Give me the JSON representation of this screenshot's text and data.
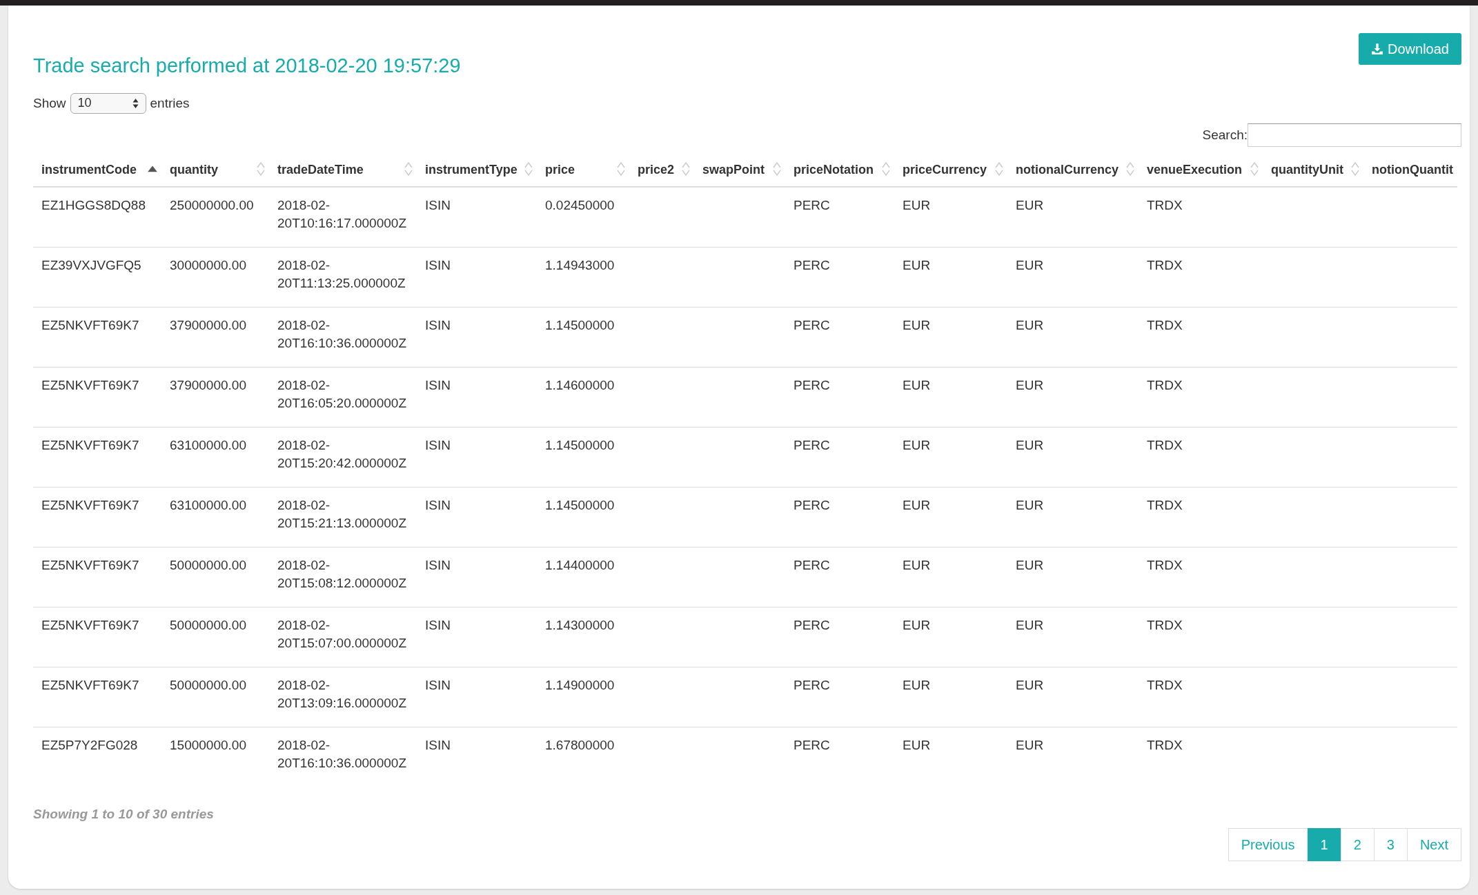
{
  "title": "Trade search performed at 2018-02-20 19:57:29",
  "download_button": "Download",
  "length_control": {
    "before": "Show",
    "value": "10",
    "after": "entries"
  },
  "search": {
    "label": "Search:"
  },
  "table": {
    "columns": [
      {
        "label": "instrumentCode",
        "sortable": true,
        "sorted": true
      },
      {
        "label": "quantity",
        "sortable": true,
        "sorted": false
      },
      {
        "label": "tradeDateTime",
        "sortable": true,
        "sorted": false
      },
      {
        "label": "instrumentType",
        "sortable": true,
        "sorted": false
      },
      {
        "label": "price",
        "sortable": true,
        "sorted": false
      },
      {
        "label": "price2",
        "sortable": true,
        "sorted": false
      },
      {
        "label": "swapPoint",
        "sortable": true,
        "sorted": false
      },
      {
        "label": "priceNotation",
        "sortable": true,
        "sorted": false
      },
      {
        "label": "priceCurrency",
        "sortable": true,
        "sorted": false
      },
      {
        "label": "notionalCurrency",
        "sortable": true,
        "sorted": false
      },
      {
        "label": "venueExecution",
        "sortable": true,
        "sorted": false
      },
      {
        "label": "quantityUnit",
        "sortable": true,
        "sorted": false
      },
      {
        "label": "notionQuantit"
      }
    ],
    "rows": [
      [
        "EZ1HGGS8DQ88",
        "250000000.00",
        "2018-02-20T10:16:17.000000Z",
        "ISIN",
        "0.02450000",
        null,
        null,
        "PERC",
        "EUR",
        "EUR",
        "TRDX"
      ],
      [
        "EZ39VXJVGFQ5",
        "30000000.00",
        "2018-02-20T11:13:25.000000Z",
        "ISIN",
        "1.14943000",
        null,
        null,
        "PERC",
        "EUR",
        "EUR",
        "TRDX"
      ],
      [
        "EZ5NKVFT69K7",
        "37900000.00",
        "2018-02-20T16:10:36.000000Z",
        "ISIN",
        "1.14500000",
        null,
        null,
        "PERC",
        "EUR",
        "EUR",
        "TRDX"
      ],
      [
        "EZ5NKVFT69K7",
        "37900000.00",
        "2018-02-20T16:05:20.000000Z",
        "ISIN",
        "1.14600000",
        null,
        null,
        "PERC",
        "EUR",
        "EUR",
        "TRDX"
      ],
      [
        "EZ5NKVFT69K7",
        "63100000.00",
        "2018-02-20T15:20:42.000000Z",
        "ISIN",
        "1.14500000",
        null,
        null,
        "PERC",
        "EUR",
        "EUR",
        "TRDX"
      ],
      [
        "EZ5NKVFT69K7",
        "63100000.00",
        "2018-02-20T15:21:13.000000Z",
        "ISIN",
        "1.14500000",
        null,
        null,
        "PERC",
        "EUR",
        "EUR",
        "TRDX"
      ],
      [
        "EZ5NKVFT69K7",
        "50000000.00",
        "2018-02-20T15:08:12.000000Z",
        "ISIN",
        "1.14400000",
        null,
        null,
        "PERC",
        "EUR",
        "EUR",
        "TRDX"
      ],
      [
        "EZ5NKVFT69K7",
        "50000000.00",
        "2018-02-20T15:07:00.000000Z",
        "ISIN",
        "1.14300000",
        null,
        null,
        "PERC",
        "EUR",
        "EUR",
        "TRDX"
      ],
      [
        "EZ5NKVFT69K7",
        "50000000.00",
        "2018-02-20T13:09:16.000000Z",
        "ISIN",
        "1.14900000",
        null,
        null,
        "PERC",
        "EUR",
        "EUR",
        "TRDX"
      ],
      [
        "EZ5P7Y2FG028",
        "15000000.00",
        "2018-02-20T16:10:36.000000Z",
        "ISIN",
        "1.67800000",
        null,
        null,
        "PERC",
        "EUR",
        "EUR",
        "TRDX"
      ]
    ]
  },
  "info": "Showing 1 to 10 of 30 entries",
  "pagination": [
    {
      "label": "Previous",
      "selected": false
    },
    {
      "label": "1",
      "selected": true
    },
    {
      "label": "2",
      "selected": false
    },
    {
      "label": "3",
      "selected": false
    },
    {
      "label": "Next",
      "selected": false
    }
  ]
}
